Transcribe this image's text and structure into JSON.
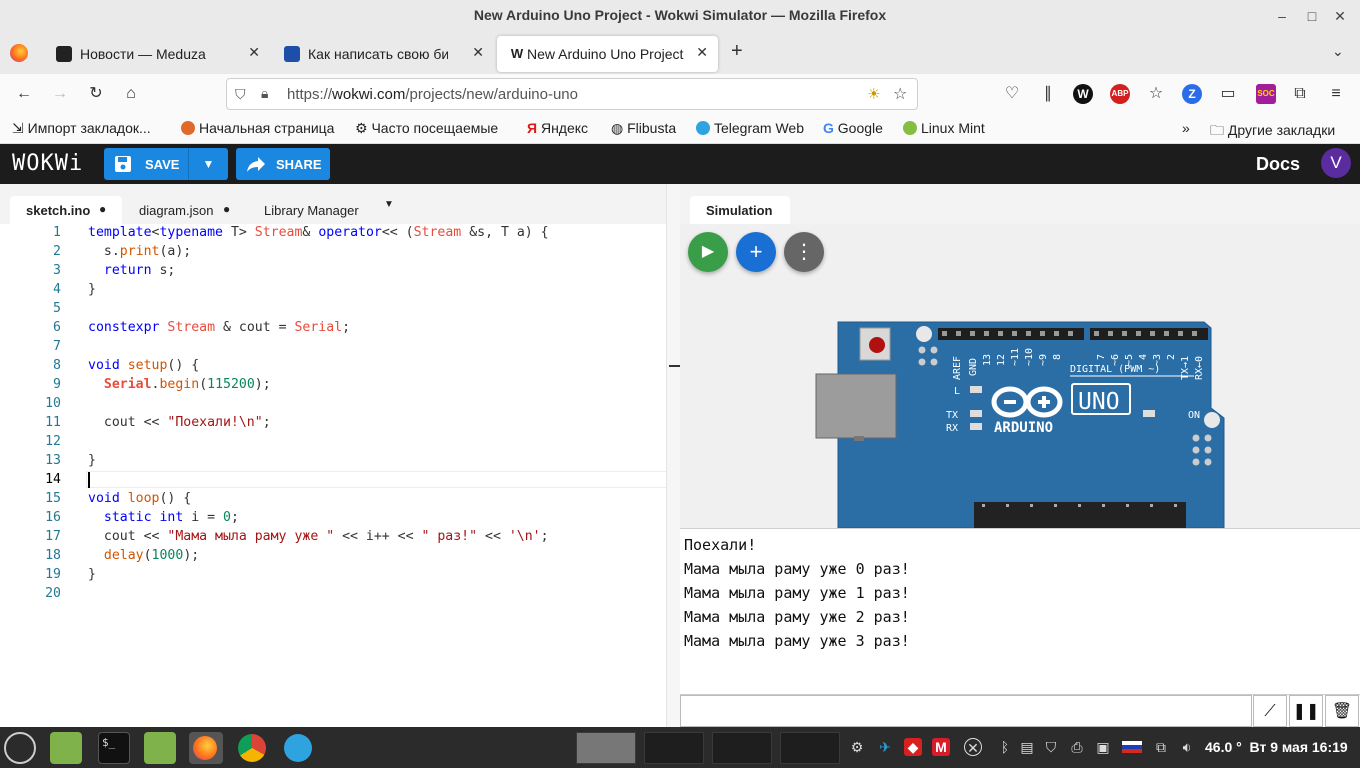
{
  "window": {
    "title": "New Arduino Uno Project - Wokwi Simulator — Mozilla Firefox"
  },
  "tabs": [
    {
      "label": "Новости — Meduza"
    },
    {
      "label": "Как написать свою библ"
    },
    {
      "label": "New Arduino Uno Project"
    }
  ],
  "navbar": {
    "url_prefix": "https://",
    "url_host": "wokwi.com",
    "url_path": "/projects/new/arduino-uno"
  },
  "bookmarks": [
    "Импорт закладок...",
    "Начальная страница",
    "Часто посещаемые",
    "Яндекс",
    "Flibusta",
    "Telegram Web",
    "Google",
    "Linux Mint",
    "Другие закладки"
  ],
  "wokwi": {
    "logo": "WOKWi",
    "save_label": "SAVE",
    "share_label": "SHARE",
    "docs_label": "Docs",
    "avatar_initial": "V"
  },
  "editor": {
    "tabs": [
      "sketch.ino",
      "diagram.json",
      "Library Manager"
    ],
    "line_numbers": [
      "1",
      "2",
      "3",
      "4",
      "5",
      "6",
      "7",
      "8",
      "9",
      "10",
      "11",
      "12",
      "13",
      "14",
      "15",
      "16",
      "17",
      "18",
      "19",
      "20"
    ]
  },
  "simulation": {
    "tab_label": "Simulation",
    "board": {
      "labels": [
        "AREF",
        "GND",
        "13",
        "12",
        "~11",
        "~10",
        "~9",
        "8",
        "7",
        "~6",
        "~5",
        "4",
        "~3",
        "2",
        "TX→1",
        "RX←0"
      ],
      "digital": "DIGITAL (PWM ~)",
      "tx": "TX",
      "rx": "RX",
      "l": "L",
      "on": "ON",
      "brand": "ARDUINO",
      "model": "UNO"
    }
  },
  "serial": {
    "lines": [
      "Поехали!",
      "Мама мыла раму уже 0 раз!",
      "Мама мыла раму уже 1 раз!",
      "Мама мыла раму уже 2 раз!",
      "Мама мыла раму уже 3 раз!"
    ]
  },
  "taskbar": {
    "temp": "46.0 °",
    "clock": "Вт  9 мая 16:19"
  },
  "colors": {
    "wokwi_header": "#1c1c1c",
    "accent": "#1a88e0",
    "board_blue": "#2b6ea6",
    "play_green": "#3a9e48"
  }
}
